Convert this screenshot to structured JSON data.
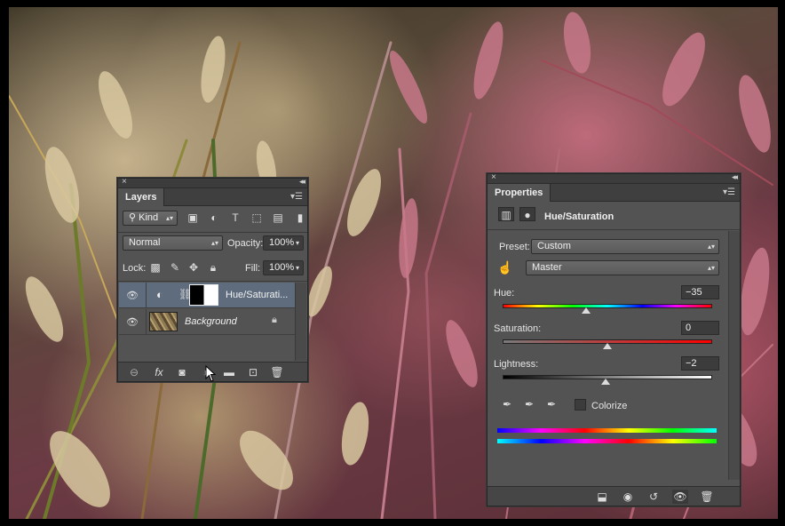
{
  "layers_panel": {
    "tab": "Layers",
    "filter_kind": "Kind",
    "blend_mode": "Normal",
    "opacity_label": "Opacity:",
    "opacity_value": "100%",
    "lock_label": "Lock:",
    "fill_label": "Fill:",
    "fill_value": "100%",
    "layers": [
      {
        "name": "Hue/Saturati...",
        "selected": true
      },
      {
        "name": "Background",
        "selected": false
      }
    ]
  },
  "properties_panel": {
    "tab": "Properties",
    "title": "Hue/Saturation",
    "preset_label": "Preset:",
    "preset_value": "Custom",
    "channel_value": "Master",
    "hue_label": "Hue:",
    "hue_value": "−35",
    "hue_fraction": 0.4,
    "saturation_label": "Saturation:",
    "saturation_value": "0",
    "saturation_fraction": 0.5,
    "lightness_label": "Lightness:",
    "lightness_value": "−2",
    "lightness_fraction": 0.49,
    "colorize_label": "Colorize",
    "colorize_checked": false
  },
  "colors": {
    "panel_bg": "#535353",
    "selected_row": "#5e6c7d"
  }
}
